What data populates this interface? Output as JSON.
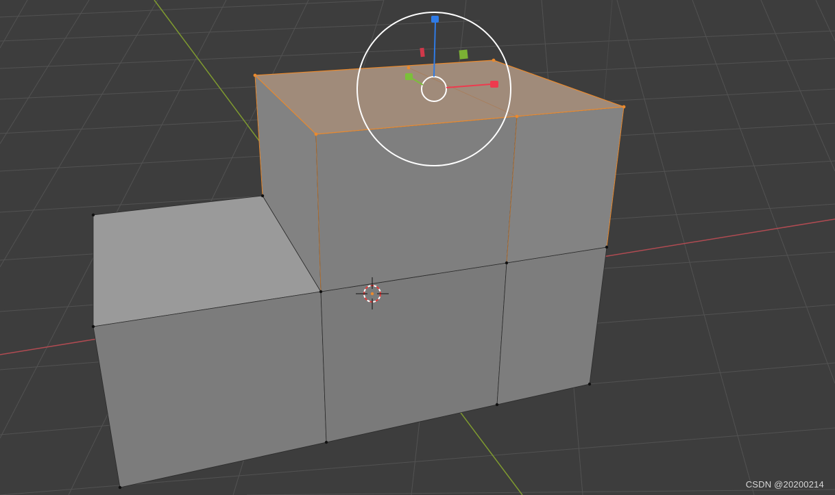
{
  "viewport": {
    "background_color": "#3d3d3d",
    "grid_color": "#555555",
    "x_axis_color": "#b14b52",
    "y_axis_color": "#7f9b2f",
    "selection_color": "#ea8a2e",
    "mesh_face_color": "#8e8e8e"
  },
  "gizmo": {
    "x_handle_color": "#ee3a4e",
    "y_handle_color": "#7bc03a",
    "z_handle_color": "#2f7be6",
    "ring_color": "#ffffff"
  },
  "icons": {
    "cursor": "3d-cursor-icon",
    "transform": "transform-gizmo-icon"
  },
  "watermark": {
    "text": "CSDN @20200214"
  }
}
